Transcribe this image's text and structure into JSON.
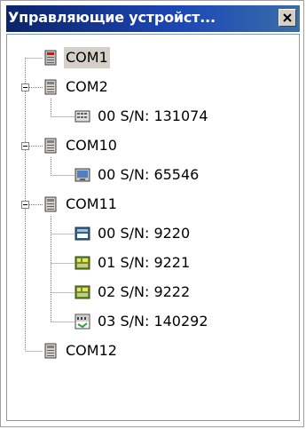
{
  "window": {
    "title": "Управляющие устройст...",
    "close_icon": "close-icon"
  },
  "tree": [
    {
      "label": "COM1",
      "icon": "com-port-icon-red",
      "selected": true
    },
    {
      "label": "COM2",
      "icon": "com-port-icon",
      "expanded": true
    },
    {
      "label": "00  S/N: 131074",
      "icon": "device-keypad-icon"
    },
    {
      "label": "COM10",
      "icon": "com-port-icon",
      "expanded": true
    },
    {
      "label": "00  S/N: 65546",
      "icon": "device-monitor-icon"
    },
    {
      "label": "COM11",
      "icon": "com-port-icon",
      "expanded": true
    },
    {
      "label": "00  S/N: 9220",
      "icon": "device-panel-icon"
    },
    {
      "label": "01  S/N: 9221",
      "icon": "device-module-icon"
    },
    {
      "label": "02  S/N: 9222",
      "icon": "device-module-icon"
    },
    {
      "label": "03  S/N: 140292",
      "icon": "device-cpc-icon"
    },
    {
      "label": "COM12",
      "icon": "com-port-icon"
    }
  ]
}
